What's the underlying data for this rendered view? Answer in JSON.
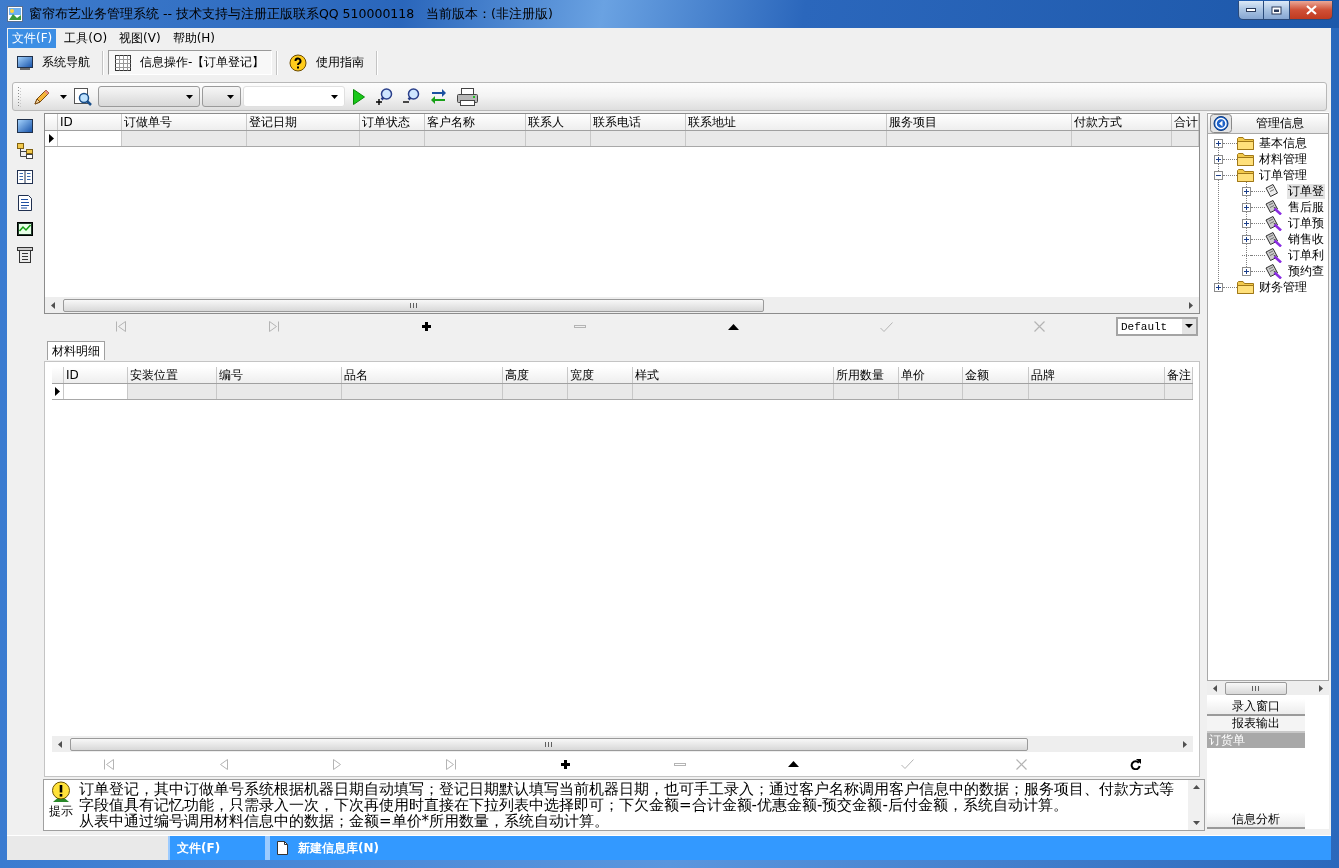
{
  "window": {
    "title": "窗帘布艺业务管理系统 -- 技术支持与注册正版联系QQ 510000118   当前版本：(非注册版)"
  },
  "menu": [
    {
      "label": "文件(F)",
      "selected": true
    },
    {
      "label": "工具(O)",
      "selected": false
    },
    {
      "label": "视图(V)",
      "selected": false
    },
    {
      "label": "帮助(H)",
      "selected": false
    }
  ],
  "toolbar": {
    "buttons": [
      {
        "label": "系统导航",
        "kind": "monitor",
        "selected": false
      },
      {
        "label": "信息操作-【订单登记】",
        "kind": "grid",
        "selected": true
      },
      {
        "label": "使用指南",
        "kind": "help",
        "selected": false
      }
    ]
  },
  "master_grid": {
    "columns": [
      "ID",
      "订做单号",
      "登记日期",
      "订单状态",
      "客户名称",
      "联系人",
      "联系电话",
      "联系地址",
      "服务项目",
      "付款方式",
      "合计"
    ]
  },
  "master_navigator": {
    "buttons": [
      {
        "kind": "first",
        "disabled": true
      },
      {
        "kind": "last",
        "disabled": true
      },
      {
        "kind": "insert",
        "disabled": false
      },
      {
        "kind": "delete",
        "disabled": true
      },
      {
        "kind": "edit",
        "disabled": false
      },
      {
        "kind": "post",
        "disabled": true
      },
      {
        "kind": "cancel",
        "disabled": true
      }
    ],
    "layout": "Default"
  },
  "detail_tabs": [
    {
      "label": "材料明细",
      "selected": true
    }
  ],
  "detail_grid": {
    "columns": [
      "ID",
      "安装位置",
      "编号",
      "品名",
      "高度",
      "宽度",
      "样式",
      "所用数量",
      "单价",
      "金额",
      "品牌",
      "备注"
    ]
  },
  "detail_navigator": {
    "buttons": [
      {
        "kind": "first",
        "disabled": true
      },
      {
        "kind": "prior",
        "disabled": true
      },
      {
        "kind": "next",
        "disabled": true
      },
      {
        "kind": "last",
        "disabled": true
      },
      {
        "kind": "insert",
        "disabled": false
      },
      {
        "kind": "delete",
        "disabled": true
      },
      {
        "kind": "edit",
        "disabled": false
      },
      {
        "kind": "post",
        "disabled": true
      },
      {
        "kind": "cancel",
        "disabled": true
      },
      {
        "kind": "refresh",
        "disabled": false
      }
    ]
  },
  "hint": {
    "label": "提示",
    "paragraphs": [
      "订单登记，其中订做单号系统根据机器日期自动填写；登记日期默认填写当前机器日期，也可手工录入；通过客户名称调用客户信息中的数据；服务项目、付款方式等字段值具有记忆功能，只需录入一次，下次再使用时直接在下拉列表中选择即可；下欠金额=合计金额-优惠金额-预交金额-后付金额，系统自动计算。",
      "从表中通过编号调用材料信息中的数据；金额=单价*所用数量，系统自动计算。"
    ]
  },
  "tree": {
    "title": "管理信息",
    "items": [
      {
        "label": "基本信息",
        "kind": "folder",
        "expandable": true,
        "expanded": false,
        "selected": false
      },
      {
        "label": "材料管理",
        "kind": "folder",
        "expandable": true,
        "expanded": false,
        "selected": false
      },
      {
        "label": "订单管理",
        "kind": "folder",
        "expandable": true,
        "expanded": true,
        "selected": false,
        "children": [
          {
            "label": "订单登",
            "kind": "report",
            "expandable": true,
            "expanded": false,
            "selected": true
          },
          {
            "label": "售后服",
            "kind": "report",
            "expandable": true,
            "expanded": false,
            "selected": false
          },
          {
            "label": "订单预",
            "kind": "report",
            "expandable": true,
            "expanded": false,
            "selected": false
          },
          {
            "label": "销售收",
            "kind": "report",
            "expandable": true,
            "expanded": false,
            "selected": false
          },
          {
            "label": "订单利",
            "kind": "report",
            "expandable": false,
            "expanded": false,
            "selected": false
          },
          {
            "label": "预约查",
            "kind": "report",
            "expandable": true,
            "expanded": false,
            "selected": false
          }
        ]
      },
      {
        "label": "财务管理",
        "kind": "folder",
        "expandable": true,
        "expanded": false,
        "selected": false
      }
    ]
  },
  "outlook_bar": {
    "groups": [
      {
        "label": "录入窗口",
        "expanded": false
      },
      {
        "label": "报表输出",
        "expanded": true,
        "items": [
          {
            "label": "订货单",
            "selected": true
          }
        ]
      },
      {
        "label": "信息分析",
        "expanded": false
      }
    ]
  },
  "status_bar": {
    "panels": [
      {
        "text": "文件(F)",
        "kind": "plain"
      },
      {
        "text": "新建信息库(N)",
        "kind": "document"
      }
    ]
  }
}
